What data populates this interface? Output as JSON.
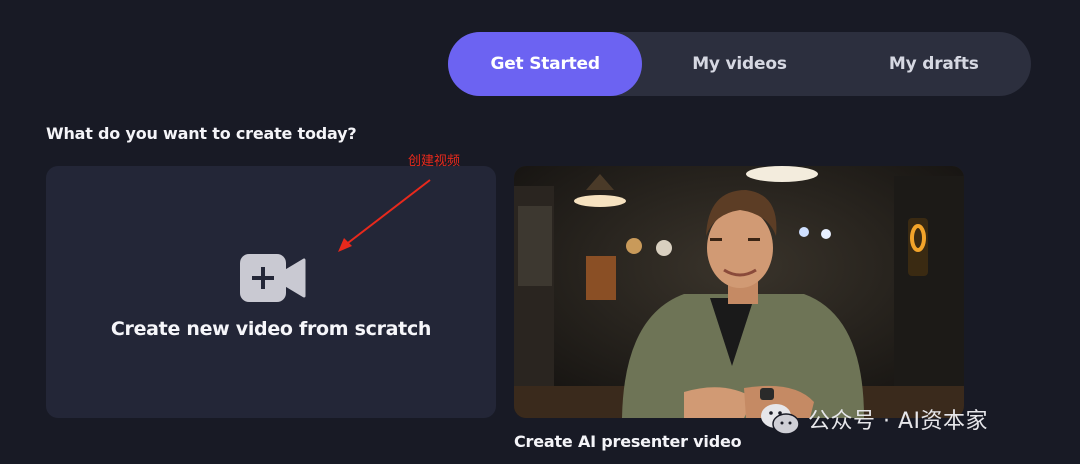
{
  "tabs": [
    {
      "label": "Get Started",
      "active": true
    },
    {
      "label": "My videos",
      "active": false
    },
    {
      "label": "My drafts",
      "active": false
    }
  ],
  "prompt": "What do you want to create today?",
  "cards": {
    "scratch": {
      "label": "Create new video from scratch",
      "icon": "video-camera-plus-icon"
    },
    "presenter": {
      "label": "Create AI presenter video",
      "image": "presenter-photo"
    }
  },
  "annotation": {
    "text": "创建视频",
    "color": "#e8291c"
  },
  "watermark": {
    "text": "公众号 · AI资本家",
    "icon": "wechat-icon"
  },
  "colors": {
    "background": "#181a25",
    "accent": "#6c63f2",
    "tab_bar": "#2c2f3e",
    "card": "#232637"
  }
}
